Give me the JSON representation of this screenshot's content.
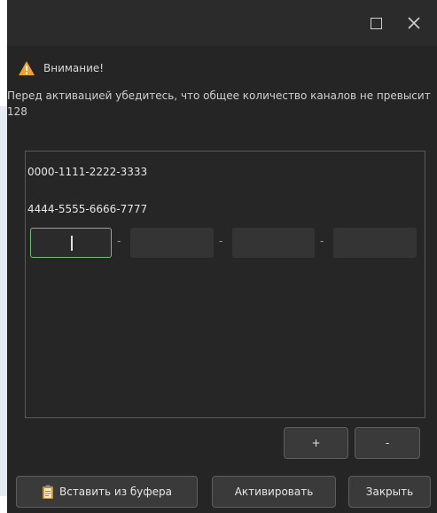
{
  "window": {
    "maximize_icon": "maximize-icon",
    "close_icon": "close-icon"
  },
  "warning": {
    "icon": "warning-icon",
    "title": "Внимание!",
    "message": "Перед активацией убедитесь, что общее количество каналов не превысит 128"
  },
  "keys": {
    "items": [
      "0000-1111-2222-3333",
      "4444-5555-6666-7777"
    ],
    "separator": "-",
    "input_segments": [
      "",
      "",
      "",
      ""
    ]
  },
  "buttons": {
    "add": "+",
    "remove": "-",
    "paste": "Вставить из буфера",
    "paste_icon": "clipboard-icon",
    "activate": "Активировать",
    "close": "Закрыть"
  },
  "colors": {
    "background": "#252526",
    "titlebar": "#2b2b2b",
    "focus_border": "#6fbf73",
    "warning": "#f0a030"
  }
}
